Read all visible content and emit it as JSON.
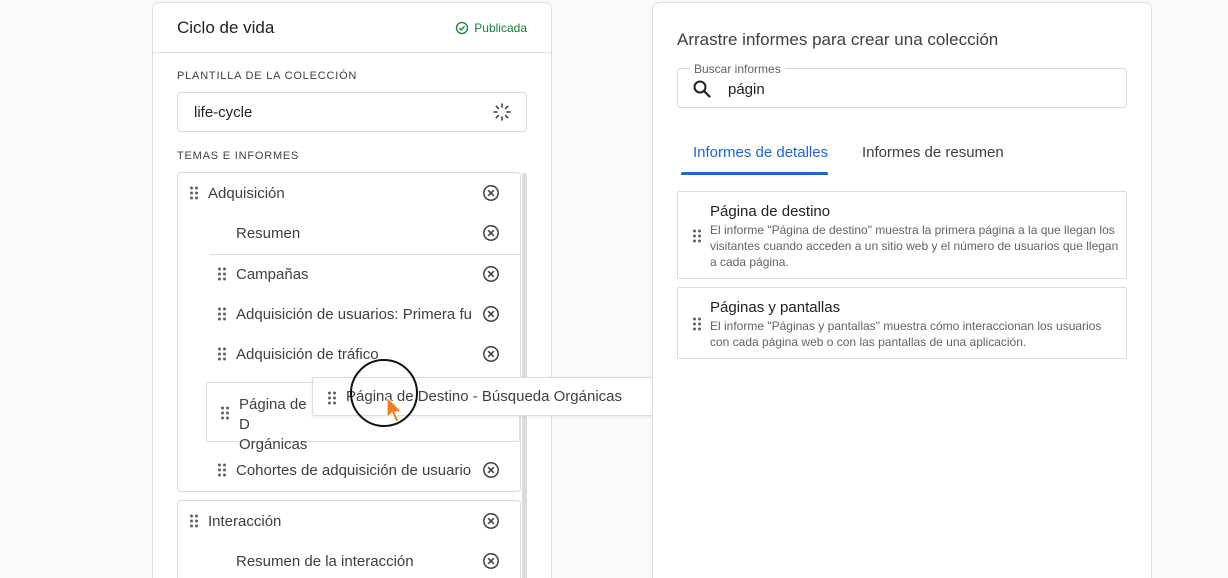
{
  "collection": {
    "title": "Ciclo de vida",
    "status": "Publicada",
    "template_label": "PLANTILLA DE LA COLECCIÓN",
    "template_value": "life-cycle",
    "topics_label": "TEMAS E INFORMES"
  },
  "topics": [
    {
      "name": "Adquisición",
      "reports": [
        "Resumen",
        "Campañas",
        "Adquisición de usuarios: Primera fu",
        "Adquisición de tráfico",
        "Cohortes de adquisición de usuario"
      ],
      "drop_slot_label": "Página de D Orgánicas"
    },
    {
      "name": "Interacción",
      "reports": [
        "Resumen de la interacción"
      ]
    }
  ],
  "dragging": {
    "label": "Página de Destino - Búsqueda Orgánicas"
  },
  "library": {
    "title": "Arrastre informes para crear una colección",
    "search_label": "Buscar informes",
    "search_value": "págin",
    "tabs": [
      "Informes de detalles",
      "Informes de resumen"
    ],
    "active_tab": "Informes de detalles",
    "results": [
      {
        "title": "Página de destino",
        "description": "El informe \"Página de destino\" muestra la primera página a la que llegan los visitantes cuando acceden a un sitio web y el número de usuarios que llegan a cada página."
      },
      {
        "title": "Páginas y pantallas",
        "description": "El informe \"Páginas y pantallas\" muestra cómo interaccionan los usuarios con cada página web o con las pantallas de una aplicación."
      }
    ]
  },
  "colors": {
    "accent": "#1967d2",
    "published": "#188038",
    "cursor": "#f07c1a"
  }
}
